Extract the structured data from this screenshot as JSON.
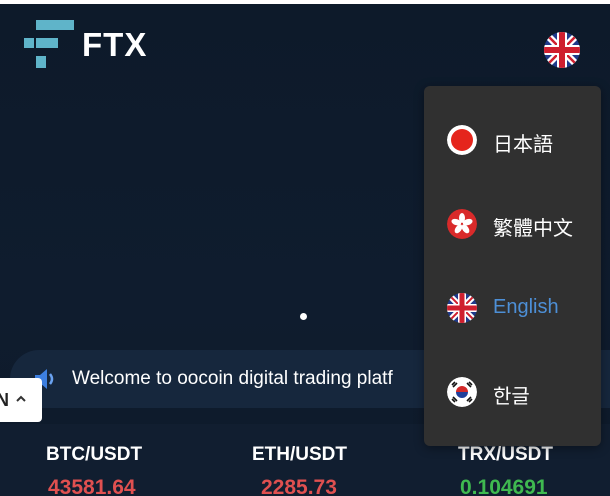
{
  "header": {
    "brand": "FTX",
    "current_language_flag": "uk-flag-icon"
  },
  "notice": {
    "text": "Welcome to oocoin digital trading platf",
    "icon": "speaker-icon"
  },
  "language_chip": {
    "text": "N"
  },
  "language_menu": {
    "items": [
      {
        "label": "日本語",
        "flag": "japan-flag-icon",
        "active": false
      },
      {
        "label": "繁體中文",
        "flag": "hong-kong-flag-icon",
        "active": false
      },
      {
        "label": "English",
        "flag": "uk-flag-icon",
        "active": true
      },
      {
        "label": "한글",
        "flag": "korea-flag-icon",
        "active": false
      }
    ]
  },
  "ticker": [
    {
      "pair": "BTC/USDT",
      "price": "43581.64",
      "color": "#e05050"
    },
    {
      "pair": "ETH/USDT",
      "price": "2285.73",
      "color": "#e05050"
    },
    {
      "pair": "TRX/USDT",
      "price": "0.104691",
      "color": "#3fb950"
    }
  ],
  "colors": {
    "background": "#0f1b2b",
    "logo_accent": "#5fb4c9",
    "menu_bg": "#303030",
    "active_language": "#4d8fd6"
  }
}
